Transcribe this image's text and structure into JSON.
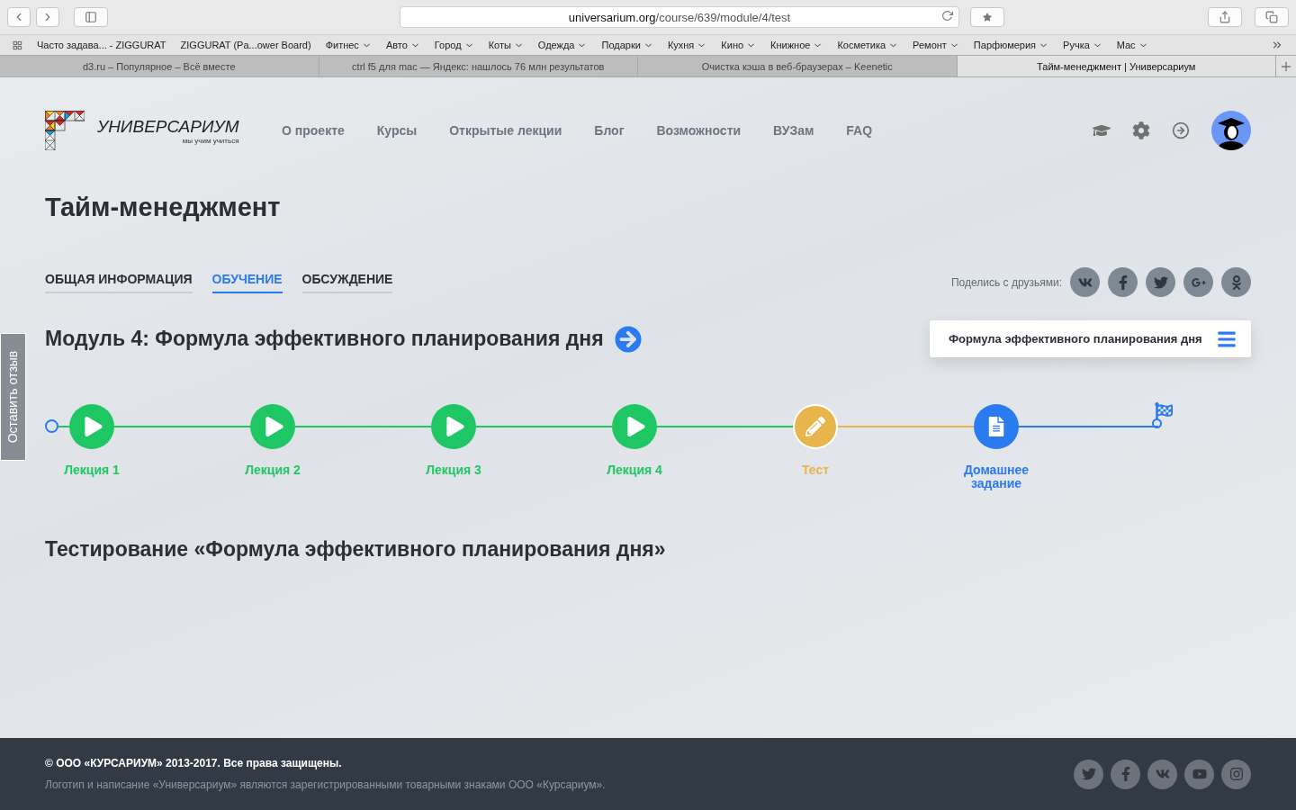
{
  "browser": {
    "address_host": "universarium.org",
    "address_path": "/course/639/module/4/test",
    "bookmarks": [
      {
        "label": "Часто задава... - ZIGGURAT",
        "dropdown": false
      },
      {
        "label": "ZIGGURAT (Pa...ower Board)",
        "dropdown": false
      },
      {
        "label": "Фитнес",
        "dropdown": true
      },
      {
        "label": "Авто",
        "dropdown": true
      },
      {
        "label": "Город",
        "dropdown": true
      },
      {
        "label": "Коты",
        "dropdown": true
      },
      {
        "label": "Одежда",
        "dropdown": true
      },
      {
        "label": "Подарки",
        "dropdown": true
      },
      {
        "label": "Кухня",
        "dropdown": true
      },
      {
        "label": "Кино",
        "dropdown": true
      },
      {
        "label": "Книжное",
        "dropdown": true
      },
      {
        "label": "Косметика",
        "dropdown": true
      },
      {
        "label": "Ремонт",
        "dropdown": true
      },
      {
        "label": "Парфюмерия",
        "dropdown": true
      },
      {
        "label": "Ручка",
        "dropdown": true
      },
      {
        "label": "Mac",
        "dropdown": true
      }
    ],
    "tabs": [
      {
        "title": "d3.ru – Популярное – Всё вместе",
        "selected": false
      },
      {
        "title": "ctrl f5 для mac — Яндекс: нашлось 76 млн результатов",
        "selected": false
      },
      {
        "title": "Очистка кэша в веб-браузерах – Keenetic",
        "selected": false
      },
      {
        "title": "Тайм-менеджмент | Универсариум",
        "selected": true
      }
    ]
  },
  "logo": {
    "name": "УНИВЕРСАРИУМ",
    "tagline": "мы учим учиться"
  },
  "nav": [
    "О проекте",
    "Курсы",
    "Открытые лекции",
    "Блог",
    "Возможности",
    "ВУЗам",
    "FAQ"
  ],
  "feedback_tab": "Оставить отзыв",
  "course_title": "Тайм-менеджмент",
  "course_tabs": [
    {
      "label": "ОБЩАЯ ИНФОРМАЦИЯ",
      "selected": false
    },
    {
      "label": "ОБУЧЕНИЕ",
      "selected": true
    },
    {
      "label": "ОБСУЖДЕНИЕ",
      "selected": false
    }
  ],
  "share_label": "Поделись с друзьями:",
  "module_title": "Модуль 4: Формула эффективного планирования дня",
  "module_menu": "Формула эффективного планирования дня",
  "timeline": [
    {
      "kind": "lecture",
      "label": "Лекция 1",
      "color": "#1ec764"
    },
    {
      "kind": "lecture",
      "label": "Лекция 2",
      "color": "#1ec764"
    },
    {
      "kind": "lecture",
      "label": "Лекция 3",
      "color": "#1ec764"
    },
    {
      "kind": "lecture",
      "label": "Лекция 4",
      "color": "#1ec764"
    },
    {
      "kind": "test",
      "label": "Тест",
      "color": "#e8b44c"
    },
    {
      "kind": "homework",
      "label": "Домашнее задание",
      "color": "#2a7af0"
    }
  ],
  "test_title": "Тестирование «Формула эффективного планирования дня»",
  "footer": {
    "copyright": "© ООО «КУРСАРИУМ» 2013-2017. Все права защищены.",
    "notice": "Логотип и написание «Универсариум» являются зарегистрированными товарными знаками ООО «Курсариум»."
  }
}
